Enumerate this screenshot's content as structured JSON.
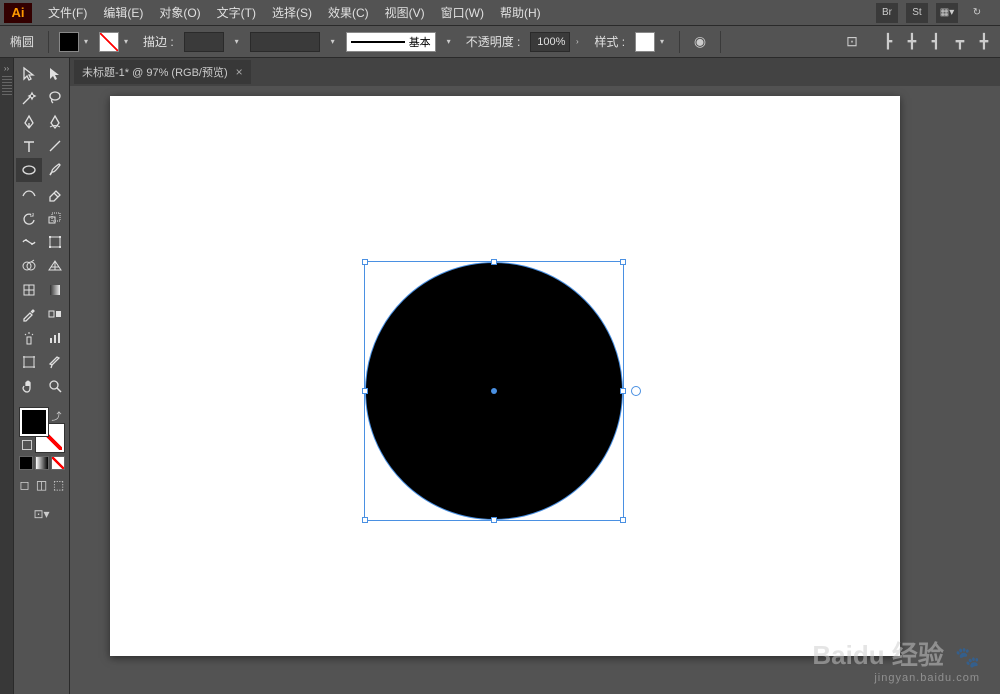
{
  "app": {
    "short": "Ai"
  },
  "menus": {
    "file": "文件(F)",
    "edit": "编辑(E)",
    "object": "对象(O)",
    "type": "文字(T)",
    "select": "选择(S)",
    "effect": "效果(C)",
    "view": "视图(V)",
    "window": "窗口(W)",
    "help": "帮助(H)"
  },
  "controlbar": {
    "shape_name": "椭圆",
    "stroke_label": "描边 :",
    "basic_label": "基本",
    "opacity_label": "不透明度 :",
    "opacity_value": "100%",
    "style_label": "样式 :"
  },
  "doc": {
    "tab_title": "未标题-1* @ 97% (RGB/预览)"
  },
  "menubar_right": {
    "br": "Br",
    "st": "St"
  },
  "watermark": {
    "main": "Baidu 经验",
    "sub": "jingyan.baidu.com"
  }
}
